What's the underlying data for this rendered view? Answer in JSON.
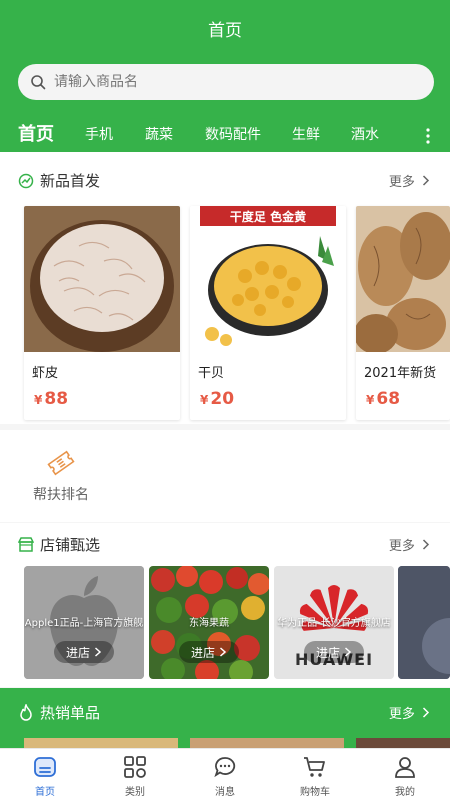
{
  "header": {
    "title": "首页"
  },
  "search": {
    "placeholder": "请输入商品名"
  },
  "tabs": [
    "首页",
    "手机",
    "蔬菜",
    "数码配件",
    "生鲜",
    "酒水"
  ],
  "new_products": {
    "title": "新品首发",
    "more": "更多",
    "items": [
      {
        "name": "虾皮",
        "currency": "¥",
        "price": "88"
      },
      {
        "name": "干贝",
        "currency": "¥",
        "price": "20",
        "banner": "干度足 色金黄"
      },
      {
        "name": "2021年新货",
        "currency": "¥",
        "price": "68"
      }
    ]
  },
  "ranking": {
    "label": "帮扶排名"
  },
  "shops": {
    "title": "店铺甄选",
    "more": "更多",
    "items": [
      {
        "name": "Apple1正品-上海官方旗舰",
        "enter": "进店"
      },
      {
        "name": "东海果蔬",
        "enter": "进店"
      },
      {
        "name": "华为正品-长沙官方旗舰店",
        "enter": "进店",
        "logo_text": "HUAWEI"
      }
    ]
  },
  "hot": {
    "title": "热销单品",
    "more": "更多"
  },
  "tabbar": {
    "items": [
      {
        "label": "首页",
        "icon": "home-icon"
      },
      {
        "label": "类别",
        "icon": "category-icon"
      },
      {
        "label": "消息",
        "icon": "message-icon"
      },
      {
        "label": "购物车",
        "icon": "cart-icon"
      },
      {
        "label": "我的",
        "icon": "profile-icon"
      }
    ]
  },
  "colors": {
    "primary": "#36b24a",
    "price": "#e65a45",
    "active_tab": "#2f6fd6"
  }
}
